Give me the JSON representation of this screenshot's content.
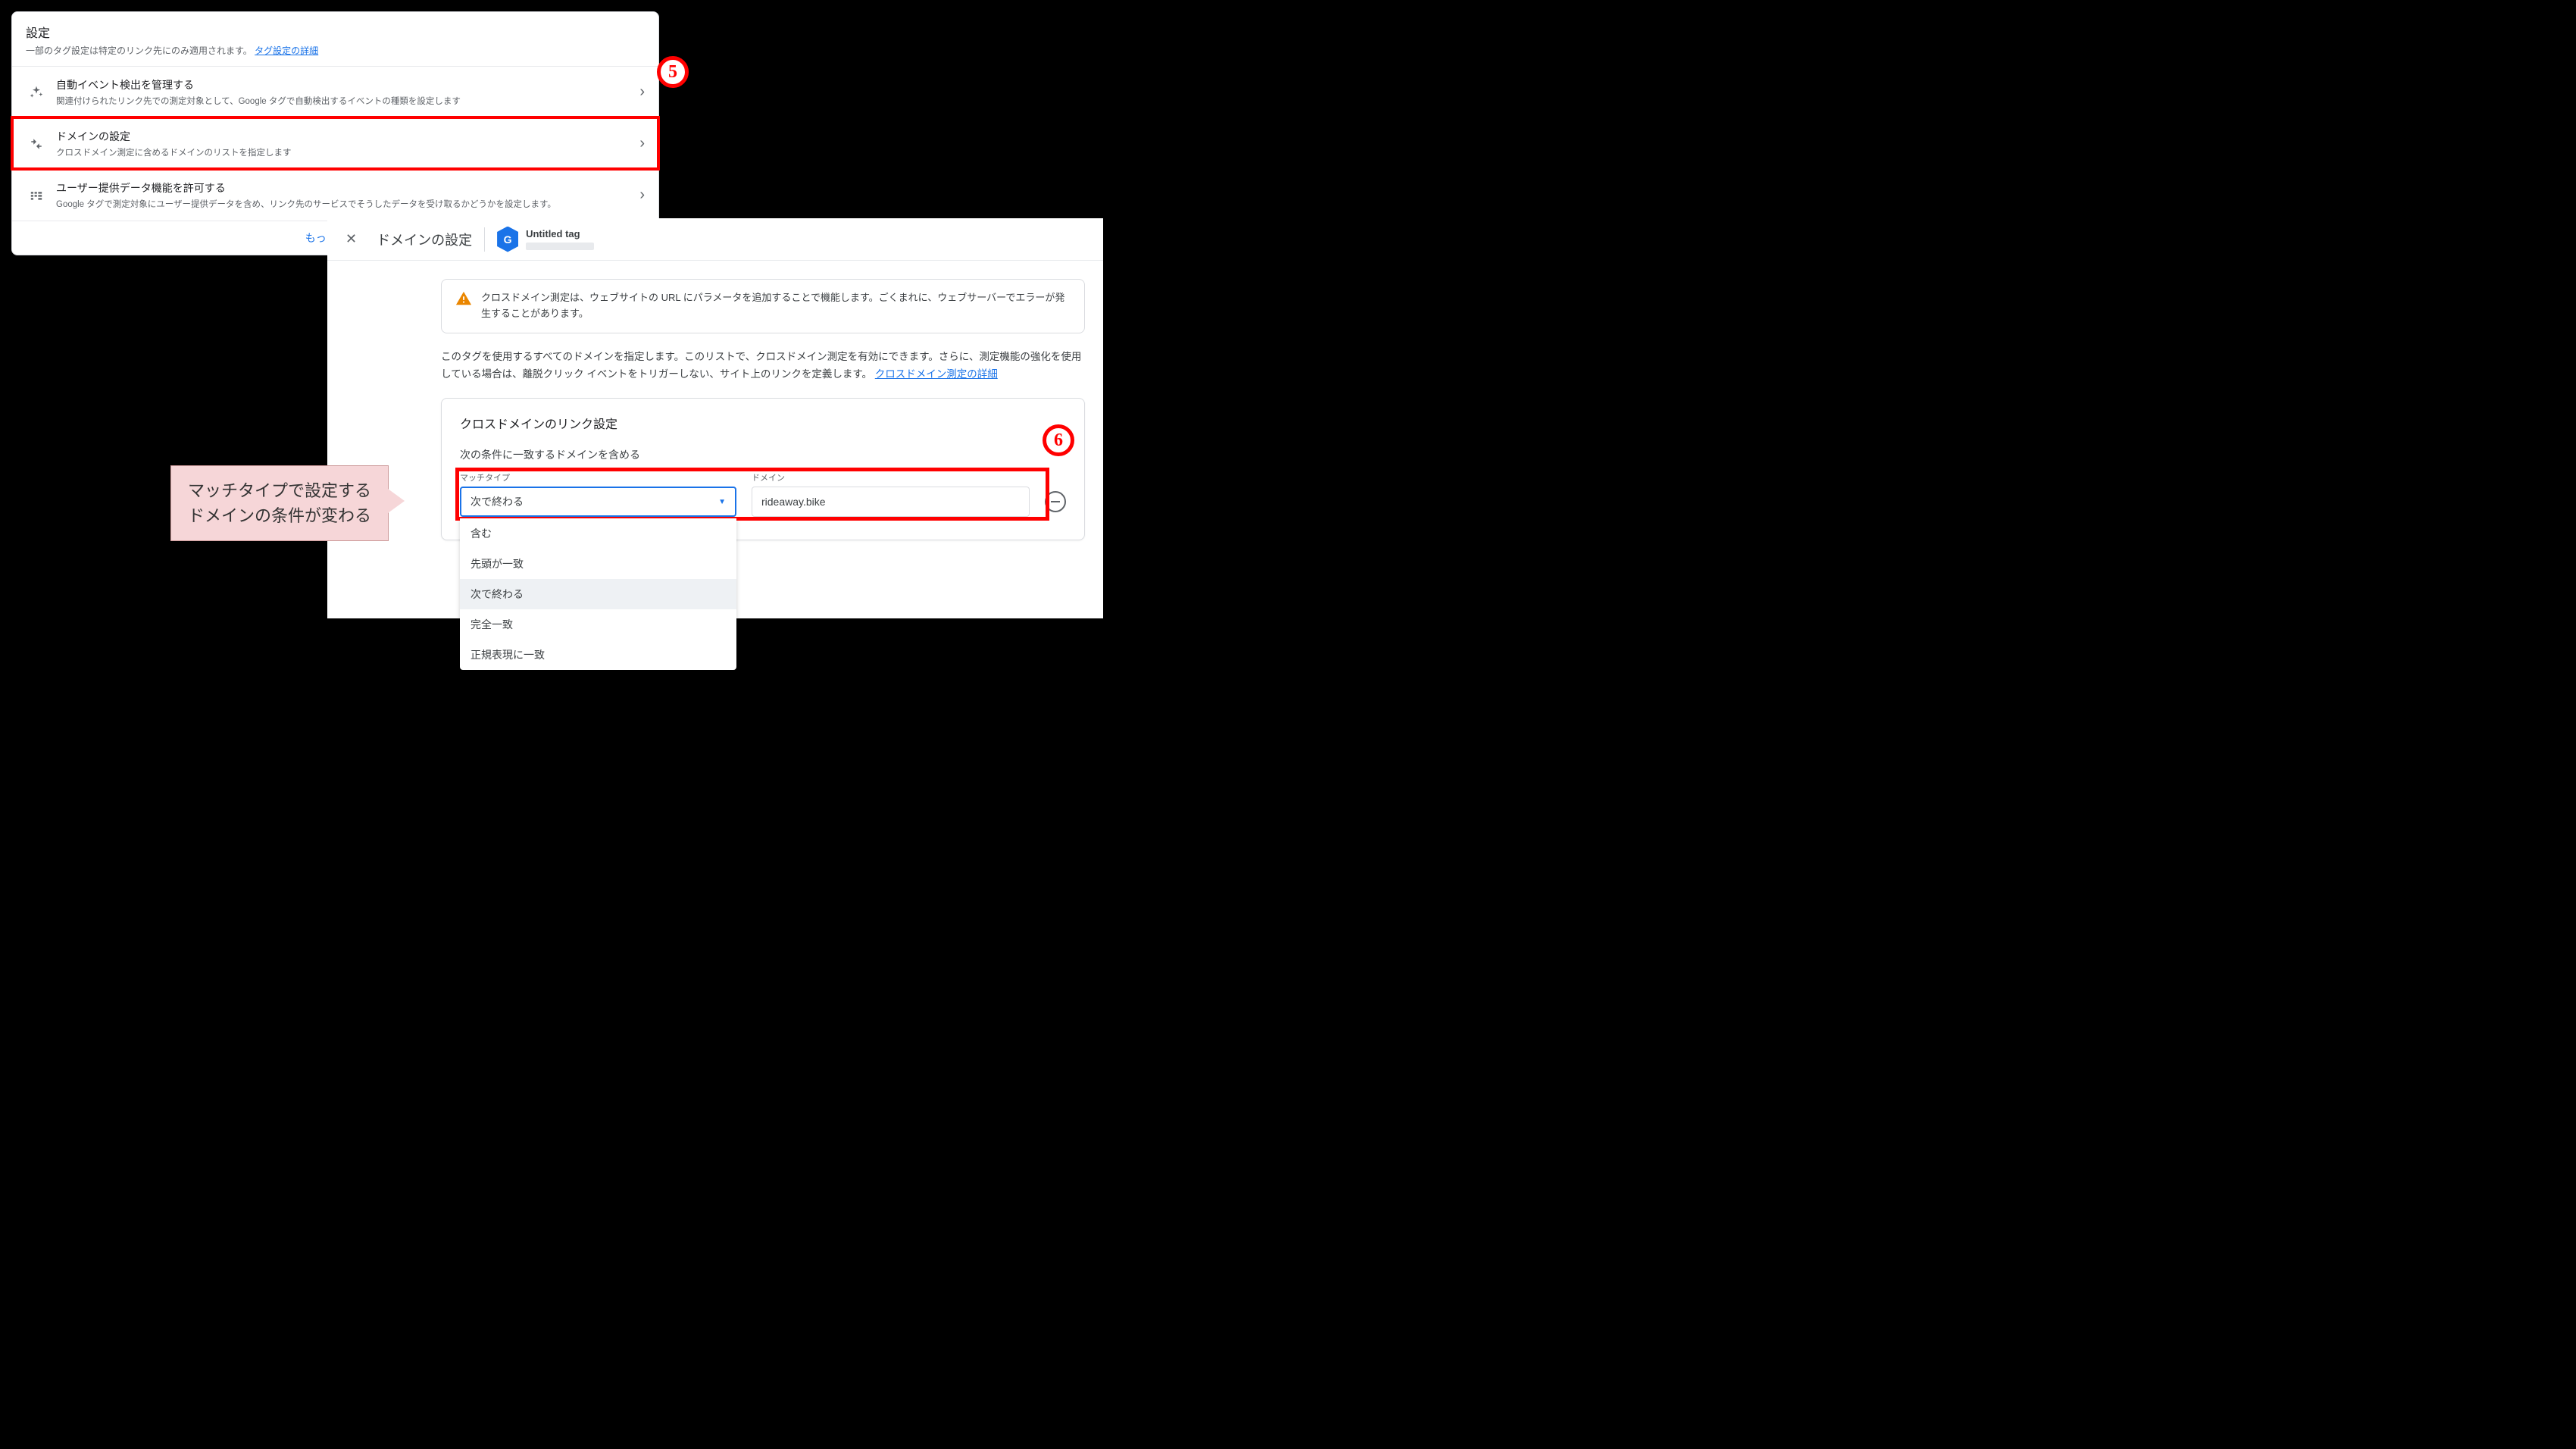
{
  "panel1": {
    "title": "設定",
    "subtitle_text": "一部のタグ設定は特定のリンク先にのみ適用されます。",
    "subtitle_link": "タグ設定の詳細",
    "rows": [
      {
        "title": "自動イベント検出を管理する",
        "desc": "関連付けられたリンク先での測定対象として、Google タグで自動検出するイベントの種類を設定します"
      },
      {
        "title": "ドメインの設定",
        "desc": "クロスドメイン測定に含めるドメインのリストを指定します"
      },
      {
        "title": "ユーザー提供データ機能を許可する",
        "desc": "Google タグで測定対象にユーザー提供データを含め、リンク先のサービスでそうしたデータを受け取るかどうかを設定します。"
      }
    ],
    "more": "もっと見る"
  },
  "panel2": {
    "bar_title": "ドメインの設定",
    "tag_name": "Untitled tag",
    "warning": "クロスドメイン測定は、ウェブサイトの URL にパラメータを追加することで機能します。ごくまれに、ウェブサーバーでエラーが発生することがあります。",
    "intro_text": "このタグを使用するすべてのドメインを指定します。このリストで、クロスドメイン測定を有効にできます。さらに、測定機能の強化を使用している場合は、離脱クリック イベントをトリガーしない、サイト上のリンクを定義します。",
    "intro_link": "クロスドメイン測定の詳細",
    "card_title": "クロスドメインのリンク設定",
    "card_sub": "次の条件に一致するドメインを含める",
    "match_label": "マッチタイプ",
    "match_value": "次で終わる",
    "domain_label": "ドメイン",
    "domain_value": "rideaway.bike",
    "dropdown": [
      "含む",
      "先頭が一致",
      "次で終わる",
      "完全一致",
      "正規表現に一致"
    ]
  },
  "annotations": {
    "badge5": "5",
    "badge6": "6",
    "callout_l1": "マッチタイプで設定する",
    "callout_l2": "ドメインの条件が変わる"
  }
}
